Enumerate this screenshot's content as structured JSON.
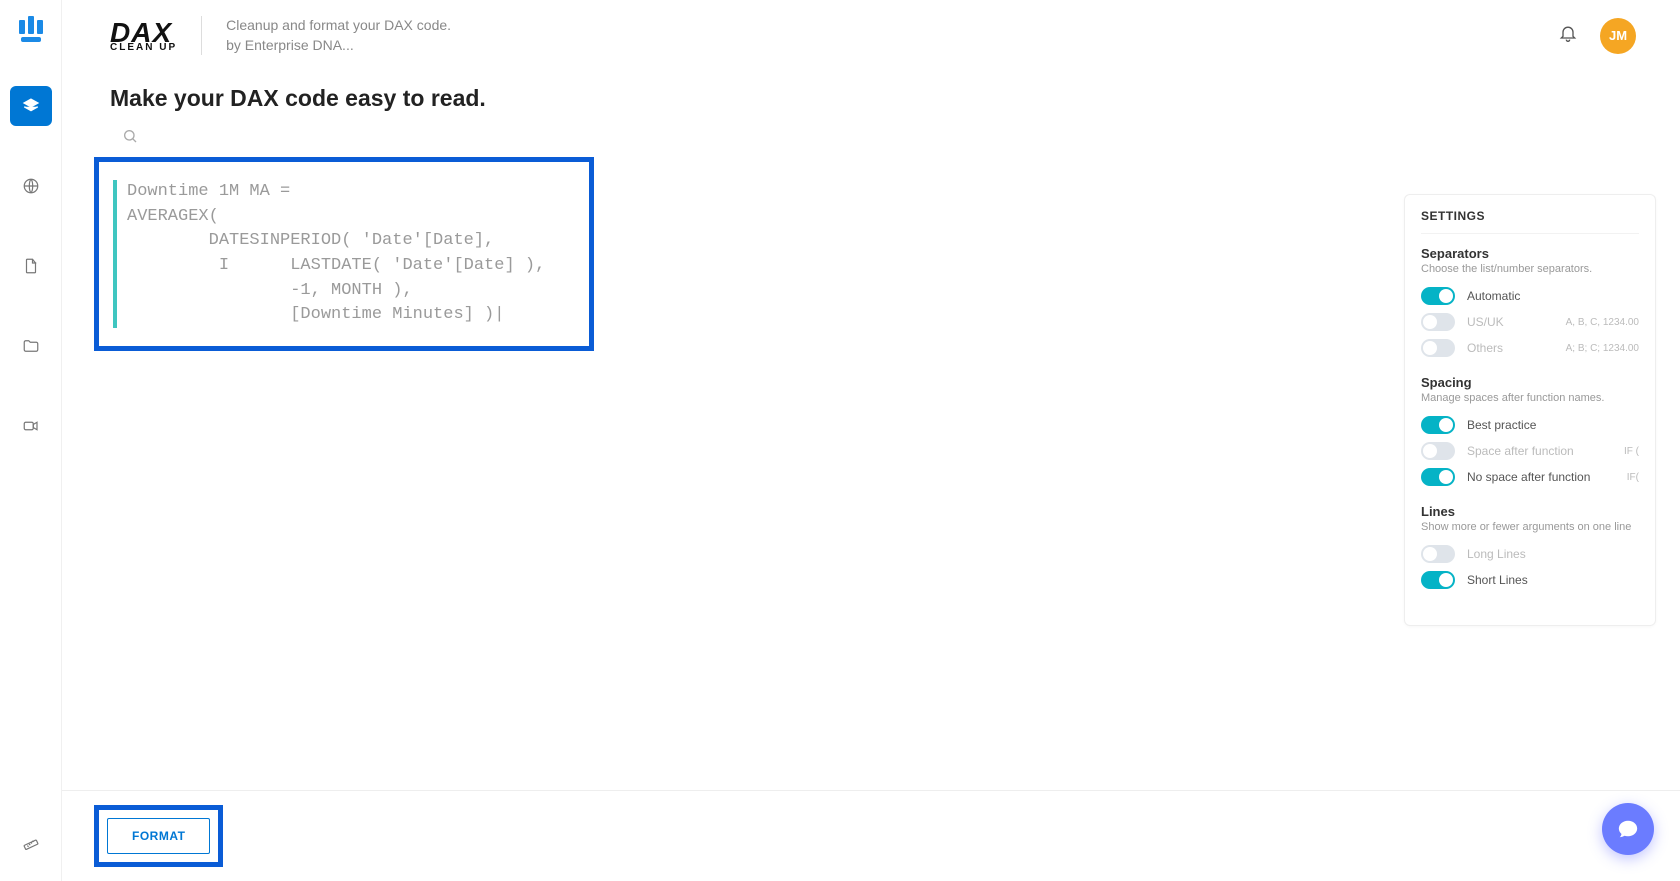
{
  "header": {
    "brand_main": "DAX",
    "brand_sub": "CLEAN UP",
    "desc_line1": "Cleanup and format your DAX code.",
    "desc_line2": "by Enterprise DNA...",
    "avatar_initials": "JM"
  },
  "page": {
    "title": "Make your DAX code easy to read."
  },
  "editor": {
    "code": "Downtime 1M MA =\nAVERAGEX(\n        DATESINPERIOD( 'Date'[Date],\n         I      LASTDATE( 'Date'[Date] ),\n                -1, MONTH ),\n                [Downtime Minutes] )|"
  },
  "settings": {
    "panel_title": "SETTINGS",
    "separators": {
      "title": "Separators",
      "hint": "Choose the list/number separators.",
      "options": {
        "automatic_label": "Automatic",
        "usuk_label": "US/UK",
        "usuk_demo": "A, B, C, 1234.00",
        "others_label": "Others",
        "others_demo": "A; B; C; 1234.00"
      },
      "state": {
        "automatic": true,
        "usuk": false,
        "others": false
      }
    },
    "spacing": {
      "title": "Spacing",
      "hint": "Manage spaces after function names.",
      "options": {
        "best_label": "Best practice",
        "space_label": "Space after function",
        "space_demo": "IF (",
        "nospace_label": "No space after function",
        "nospace_demo": "IF("
      },
      "state": {
        "best": true,
        "space": false,
        "nospace": true
      }
    },
    "lines": {
      "title": "Lines",
      "hint": "Show more or fewer arguments on one line",
      "options": {
        "long_label": "Long Lines",
        "short_label": "Short Lines"
      },
      "state": {
        "long": false,
        "short": true
      }
    }
  },
  "footer": {
    "format_label": "FORMAT"
  }
}
